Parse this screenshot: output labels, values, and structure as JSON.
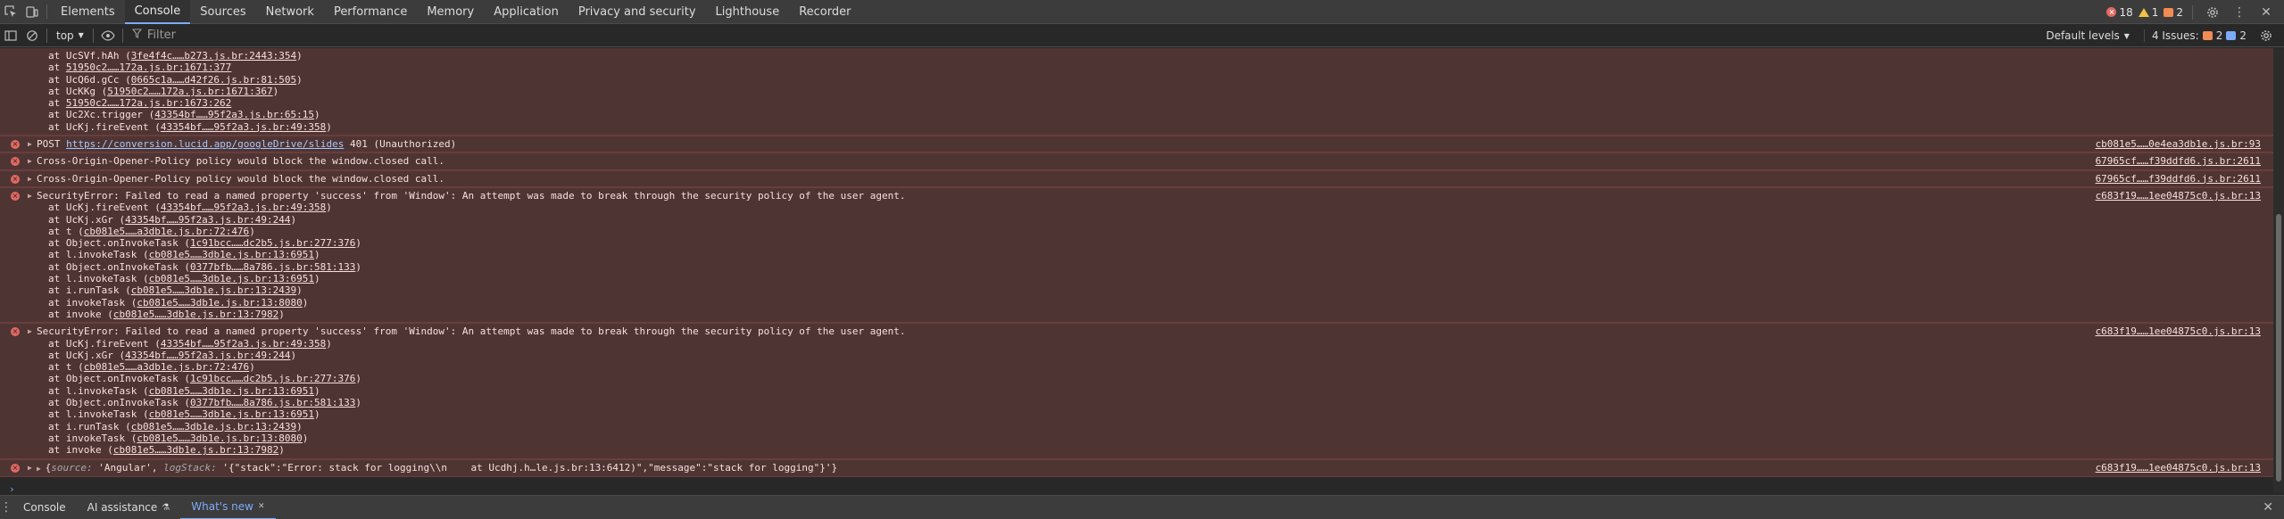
{
  "tabs": [
    {
      "label": "Elements",
      "active": false
    },
    {
      "label": "Console",
      "active": true
    },
    {
      "label": "Sources",
      "active": false
    },
    {
      "label": "Network",
      "active": false
    },
    {
      "label": "Performance",
      "active": false
    },
    {
      "label": "Memory",
      "active": false
    },
    {
      "label": "Application",
      "active": false
    },
    {
      "label": "Privacy and security",
      "active": false
    },
    {
      "label": "Lighthouse",
      "active": false
    },
    {
      "label": "Recorder",
      "active": false
    }
  ],
  "counters": {
    "errors": "18",
    "warnings": "1",
    "issues": "2"
  },
  "toolbar": {
    "context": "top",
    "filter_placeholder": "Filter",
    "levels": "Default levels",
    "issues_label": "4 Issues:",
    "issues_a": "2",
    "issues_b": "2"
  },
  "messages": [
    {
      "head": "",
      "source": "",
      "stack": [
        [
          "at UcSVf.hAh (",
          "3fe4f4c……b273.js.br:2443:354",
          ")"
        ],
        [
          "at ",
          "51950c2……172a.js.br:1671:377",
          ""
        ],
        [
          "at UcQ6d.gCc (",
          "0665c1a……d42f26.js.br:81:505",
          ")"
        ],
        [
          "at UcKKg (",
          "51950c2……172a.js.br:1671:367",
          ")"
        ],
        [
          "at ",
          "51950c2……172a.js.br:1673:262",
          ""
        ],
        [
          "at Uc2Xc.trigger (",
          "43354bf……95f2a3.js.br:65:15",
          ")"
        ],
        [
          "at UcKj.fireEvent (",
          "43354bf……95f2a3.js.br:49:358",
          ")"
        ]
      ]
    },
    {
      "head_prefix": "POST ",
      "head_url": "https://conversion.lucid.app/googleDrive/slides",
      "head_suffix": " 401 (Unauthorized)",
      "source": "cb081e5……0e4ea3db1e.js.br:93",
      "stack": []
    },
    {
      "head": "Cross-Origin-Opener-Policy policy would block the window.closed call.",
      "source": "67965cf……f39ddfd6.js.br:2611",
      "stack": []
    },
    {
      "head": "Cross-Origin-Opener-Policy policy would block the window.closed call.",
      "source": "67965cf……f39ddfd6.js.br:2611",
      "stack": []
    },
    {
      "head": "SecurityError: Failed to read a named property 'success' from 'Window': An attempt was made to break through the security policy of the user agent.",
      "source": "c683f19……1ee04875c0.js.br:13",
      "stack": [
        [
          "at UcKj.fireEvent (",
          "43354bf……95f2a3.js.br:49:358",
          ")"
        ],
        [
          "at UcKj.xGr (",
          "43354bf……95f2a3.js.br:49:244",
          ")"
        ],
        [
          "at t (",
          "cb081e5……a3db1e.js.br:72:476",
          ")"
        ],
        [
          "at Object.onInvokeTask (",
          "1c91bcc……dc2b5.js.br:277:376",
          ")"
        ],
        [
          "at l.invokeTask (",
          "cb081e5……3db1e.js.br:13:6951",
          ")"
        ],
        [
          "at Object.onInvokeTask (",
          "0377bfb……8a786.js.br:581:133",
          ")"
        ],
        [
          "at l.invokeTask (",
          "cb081e5……3db1e.js.br:13:6951",
          ")"
        ],
        [
          "at i.runTask (",
          "cb081e5……3db1e.js.br:13:2439",
          ")"
        ],
        [
          "at invokeTask (",
          "cb081e5……3db1e.js.br:13:8080",
          ")"
        ],
        [
          "at invoke (",
          "cb081e5……3db1e.js.br:13:7982",
          ")"
        ]
      ]
    },
    {
      "head": "SecurityError: Failed to read a named property 'success' from 'Window': An attempt was made to break through the security policy of the user agent.",
      "source": "c683f19……1ee04875c0.js.br:13",
      "stack": [
        [
          "at UcKj.fireEvent (",
          "43354bf……95f2a3.js.br:49:358",
          ")"
        ],
        [
          "at UcKj.xGr (",
          "43354bf……95f2a3.js.br:49:244",
          ")"
        ],
        [
          "at t (",
          "cb081e5……a3db1e.js.br:72:476",
          ")"
        ],
        [
          "at Object.onInvokeTask (",
          "1c91bcc……dc2b5.js.br:277:376",
          ")"
        ],
        [
          "at l.invokeTask (",
          "cb081e5……3db1e.js.br:13:6951",
          ")"
        ],
        [
          "at Object.onInvokeTask (",
          "0377bfb……8a786.js.br:581:133",
          ")"
        ],
        [
          "at l.invokeTask (",
          "cb081e5……3db1e.js.br:13:6951",
          ")"
        ],
        [
          "at i.runTask (",
          "cb081e5……3db1e.js.br:13:2439",
          ")"
        ],
        [
          "at invokeTask (",
          "cb081e5……3db1e.js.br:13:8080",
          ")"
        ],
        [
          "at invoke (",
          "cb081e5……3db1e.js.br:13:7982",
          ")"
        ]
      ]
    },
    {
      "obj_key1": "source:",
      "obj_val1": " 'Angular', ",
      "obj_key2": "logStack:",
      "obj_val2": " '{\"stack\":\"Error: stack for logging\\\\n    at Ucdhj.h…le.js.br:13:6412)\",\"message\":\"stack for logging\"}'}",
      "source": "c683f19……1ee04875c0.js.br:13",
      "stack": []
    }
  ],
  "drawer": {
    "tabs": [
      {
        "label": "Console",
        "active": false
      },
      {
        "label": "AI assistance",
        "active": false
      },
      {
        "label": "What's new",
        "active": true
      }
    ]
  }
}
